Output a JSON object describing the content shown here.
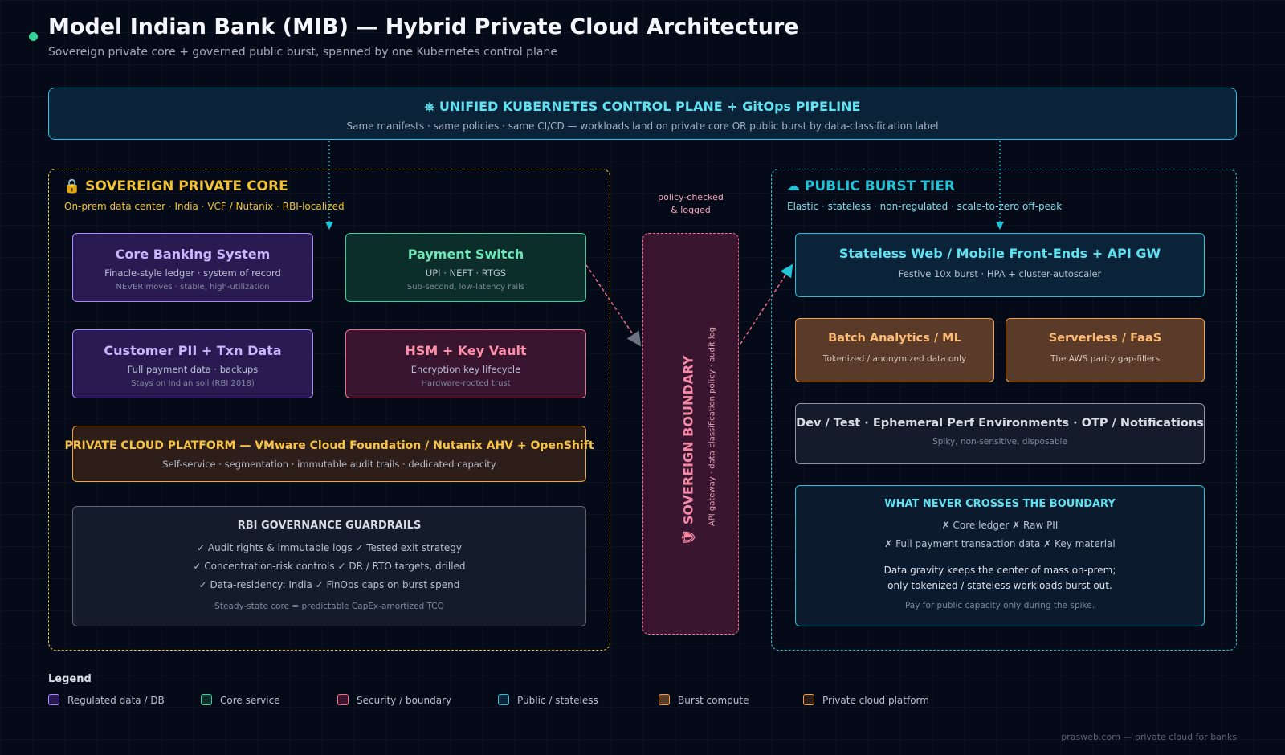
{
  "header": {
    "title": "Model Indian Bank (MIB) — Hybrid Private Cloud Architecture",
    "subtitle": "Sovereign private core + governed public burst, spanned by one Kubernetes control plane"
  },
  "control_plane": {
    "title": "⎈ UNIFIED KUBERNETES CONTROL PLANE + GitOps PIPELINE",
    "subtitle": "Same manifests · same policies · same CI/CD — workloads land on private core OR public burst by data-classification label"
  },
  "private_core": {
    "title": "🔒 SOVEREIGN PRIVATE CORE",
    "subtitle": "On-prem data center · India · VCF / Nutanix · RBI-localized",
    "core_banking": {
      "title": "Core Banking System",
      "line1": "Finacle-style ledger · system of record",
      "line2": "NEVER moves · stable, high-utilization"
    },
    "payment_switch": {
      "title": "Payment Switch",
      "line1": "UPI · NEFT · RTGS",
      "line2": "Sub-second, low-latency rails"
    },
    "customer_pii": {
      "title": "Customer PII + Txn Data",
      "line1": "Full payment data · backups",
      "line2": "Stays on Indian soil (RBI 2018)"
    },
    "hsm": {
      "title": "HSM + Key Vault",
      "line1": "Encryption key lifecycle",
      "line2": "Hardware-rooted trust"
    },
    "platform": {
      "title": "PRIVATE CLOUD PLATFORM — VMware Cloud Foundation / Nutanix AHV + OpenShift",
      "line1": "Self-service · segmentation · immutable audit trails · dedicated capacity"
    },
    "governance": {
      "title": "RBI GOVERNANCE GUARDRAILS",
      "items": [
        "✓ Audit rights & immutable logs ✓ Tested exit strategy",
        "✓ Concentration-risk controls ✓ DR / RTO targets, drilled",
        "✓ Data-residency: India ✓ FinOps caps on burst spend"
      ],
      "footer": "Steady-state core = predictable CapEx-amortized TCO"
    }
  },
  "boundary": {
    "policy_label_1": "policy-checked",
    "policy_label_2": "& logged",
    "title": "🛡 SOVEREIGN BOUNDARY",
    "subtitle": "API gateway · data-classification policy · audit log"
  },
  "public_tier": {
    "title": "☁ PUBLIC BURST TIER",
    "subtitle": "Elastic · stateless · non-regulated · scale-to-zero off-peak",
    "frontends": {
      "title": "Stateless Web / Mobile Front-Ends + API GW",
      "line1": "Festive 10x burst · HPA + cluster-autoscaler"
    },
    "batch": {
      "title": "Batch Analytics / ML",
      "line1": "Tokenized / anonymized data only"
    },
    "serverless": {
      "title": "Serverless / FaaS",
      "line1": "The AWS parity gap-fillers"
    },
    "devtest": {
      "title": "Dev / Test · Ephemeral Perf Environments · OTP / Notifications",
      "line1": "Spiky, non-sensitive, disposable"
    },
    "never_cross": {
      "title": "WHAT NEVER CROSSES THE BOUNDARY",
      "line1": "✗ Core ledger ✗ Raw PII",
      "line2": "✗ Full payment transaction data ✗ Key material",
      "line3": "Data gravity keeps the center of mass on-prem;",
      "line4": "only tokenized / stateless workloads burst out.",
      "footer": "Pay for public capacity only during the spike."
    }
  },
  "legend": {
    "title": "Legend",
    "items": [
      {
        "label": "Regulated data / DB",
        "fill": "#2a1a52",
        "stroke": "#a78bfa"
      },
      {
        "label": "Core service",
        "fill": "#0c2e2a",
        "stroke": "#34d399"
      },
      {
        "label": "Security / boundary",
        "fill": "#3a1530",
        "stroke": "#f26b8a"
      },
      {
        "label": "Public / stateless",
        "fill": "#0b2338",
        "stroke": "#22c3d6"
      },
      {
        "label": "Burst compute",
        "fill": "#5a3a28",
        "stroke": "#f6a04d"
      },
      {
        "label": "Private cloud platform",
        "fill": "#2e1e1a",
        "stroke": "#f1a23a"
      }
    ]
  },
  "footer": "prasweb.com — private cloud for banks",
  "colors": {
    "regulated": "#a78bfa",
    "core_service": "#34d399",
    "security": "#f26b8a",
    "public": "#22c3d6",
    "burst": "#f6a04d",
    "private_zone": "#f1c232"
  }
}
